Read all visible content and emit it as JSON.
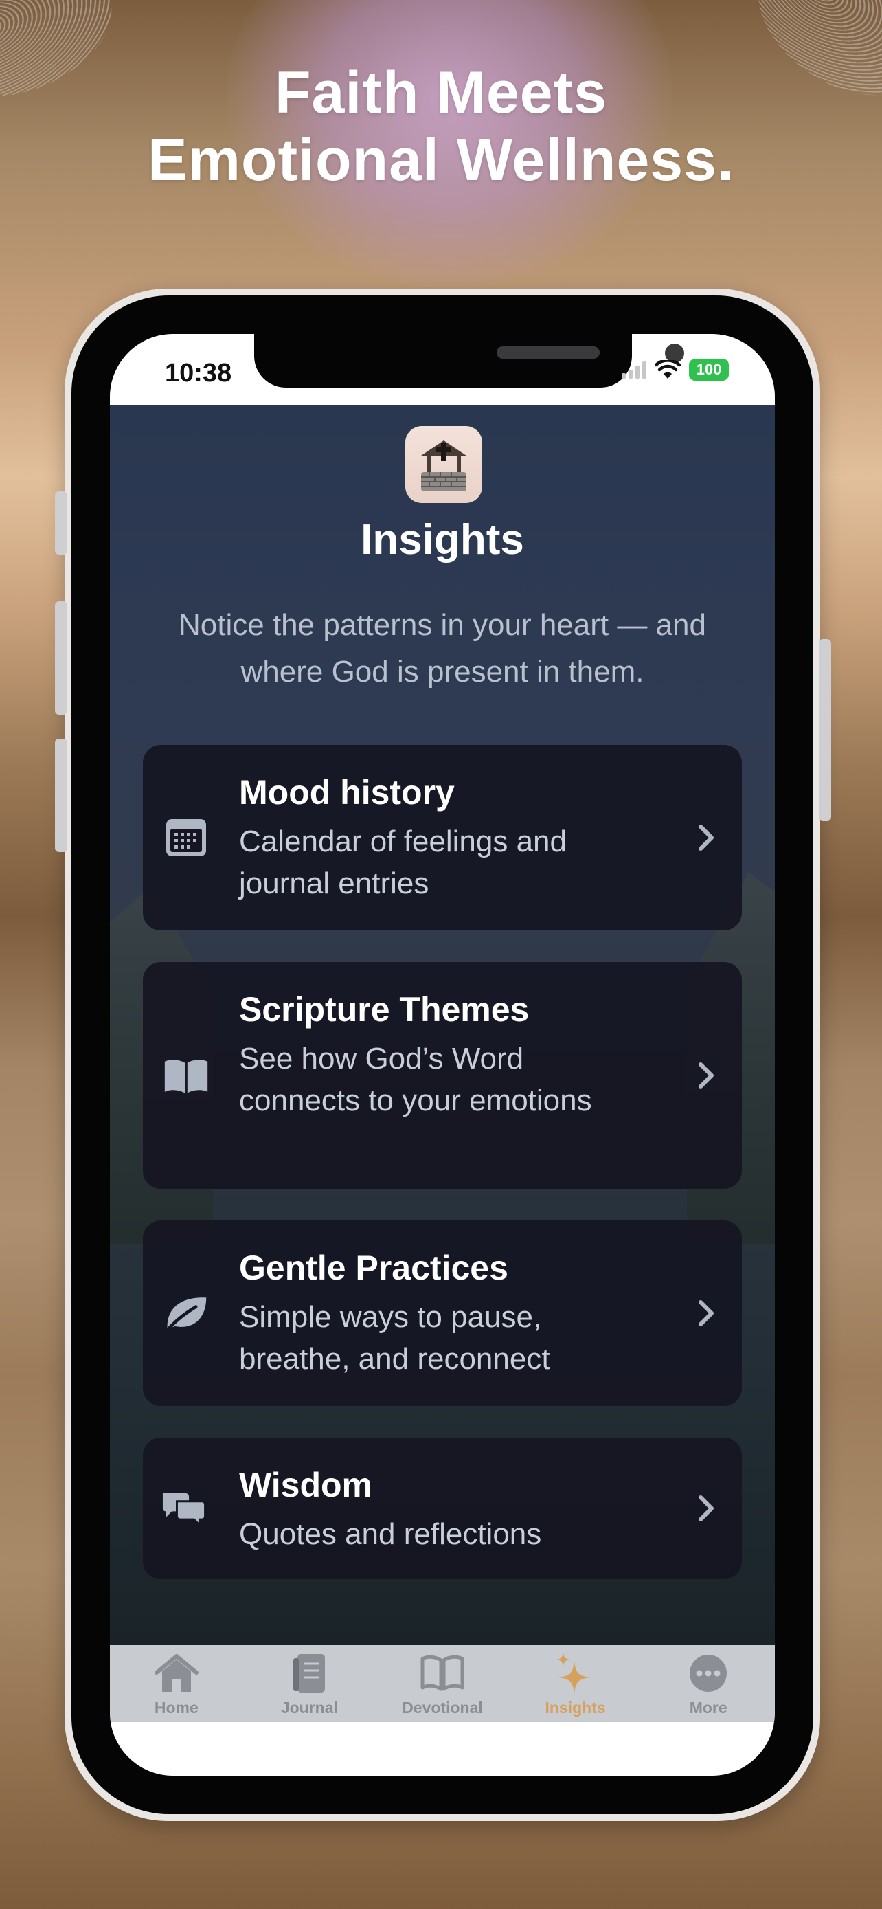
{
  "marketing": {
    "headline_line1": "Faith Meets",
    "headline_line2": "Emotional Wellness."
  },
  "status_bar": {
    "time": "10:38",
    "battery": "100"
  },
  "header": {
    "title": "Insights",
    "subtitle": "Notice the patterns in your heart — and where God is present in them."
  },
  "cards": [
    {
      "icon": "calendar-icon",
      "title": "Mood history",
      "description": "Calendar of feelings and journal entries"
    },
    {
      "icon": "open-book-icon",
      "title": "Scripture Themes",
      "description": "See how God’s Word connects to your emotions"
    },
    {
      "icon": "leaf-icon",
      "title": "Gentle Practices",
      "description": "Simple ways to pause, breathe, and reconnect"
    },
    {
      "icon": "chat-bubbles-icon",
      "title": "Wisdom",
      "description": "Quotes and reflections"
    }
  ],
  "tab_bar": {
    "tabs": [
      {
        "label": "Home",
        "icon": "home-icon"
      },
      {
        "label": "Journal",
        "icon": "journal-icon"
      },
      {
        "label": "Devotional",
        "icon": "book-icon"
      },
      {
        "label": "Insights",
        "icon": "sparkles-icon",
        "active": true
      },
      {
        "label": "More",
        "icon": "more-icon"
      }
    ]
  },
  "colors": {
    "accent": "#d6a15c",
    "card_background": "#161622",
    "battery_green": "#2fc14d"
  }
}
